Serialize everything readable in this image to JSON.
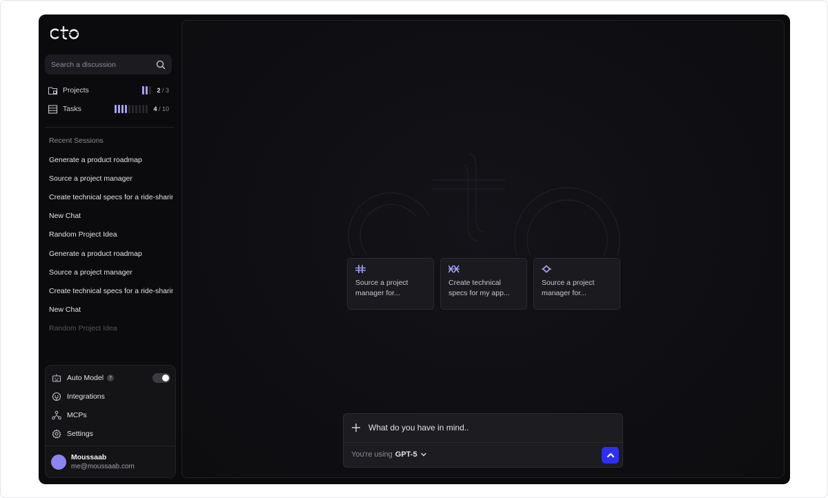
{
  "app": {
    "logo_text": "cto"
  },
  "search": {
    "placeholder": "Search a discussion",
    "icon": "search-icon"
  },
  "stats": {
    "projects": {
      "label": "Projects",
      "current": "2",
      "total": "/ 3",
      "filled": 2,
      "slots": 3,
      "icon": "folder-icon"
    },
    "tasks": {
      "label": "Tasks",
      "current": "4",
      "total": "/ 10",
      "filled": 4,
      "slots": 10,
      "icon": "table-icon"
    }
  },
  "recent": {
    "title": "Recent Sessions",
    "items": [
      "Generate a product roadmap",
      "Source a project manager",
      "Create technical specs for a ride-sharing app",
      "New Chat",
      "Random Project Idea",
      "Generate a product roadmap",
      "Source a project manager",
      "Create technical specs for a ride-sharing app",
      "New Chat",
      "Random Project Idea"
    ]
  },
  "panel": {
    "auto_model": {
      "label": "Auto Model",
      "help": "?",
      "enabled": true
    },
    "integrations": {
      "label": "Integrations"
    },
    "mcps": {
      "label": "MCPs"
    },
    "settings": {
      "label": "Settings"
    }
  },
  "user": {
    "name": "Moussaab",
    "email": "me@moussaab.com"
  },
  "suggestions": [
    {
      "text": "Source a project manager for...",
      "icon": "hash-icon"
    },
    {
      "text": "Create technical specs for my app...",
      "icon": "crossed-icon"
    },
    {
      "text": "Source a project manager for...",
      "icon": "diamond-icon"
    }
  ],
  "composer": {
    "prompt": "What do you have in mind..",
    "model_prefix": "You're using",
    "model": "GPT-5"
  },
  "colors": {
    "accent": "#a5a0f5",
    "send": "#2f2ff0",
    "avatar": "#8d84f0",
    "background": "#0b0b0d"
  }
}
